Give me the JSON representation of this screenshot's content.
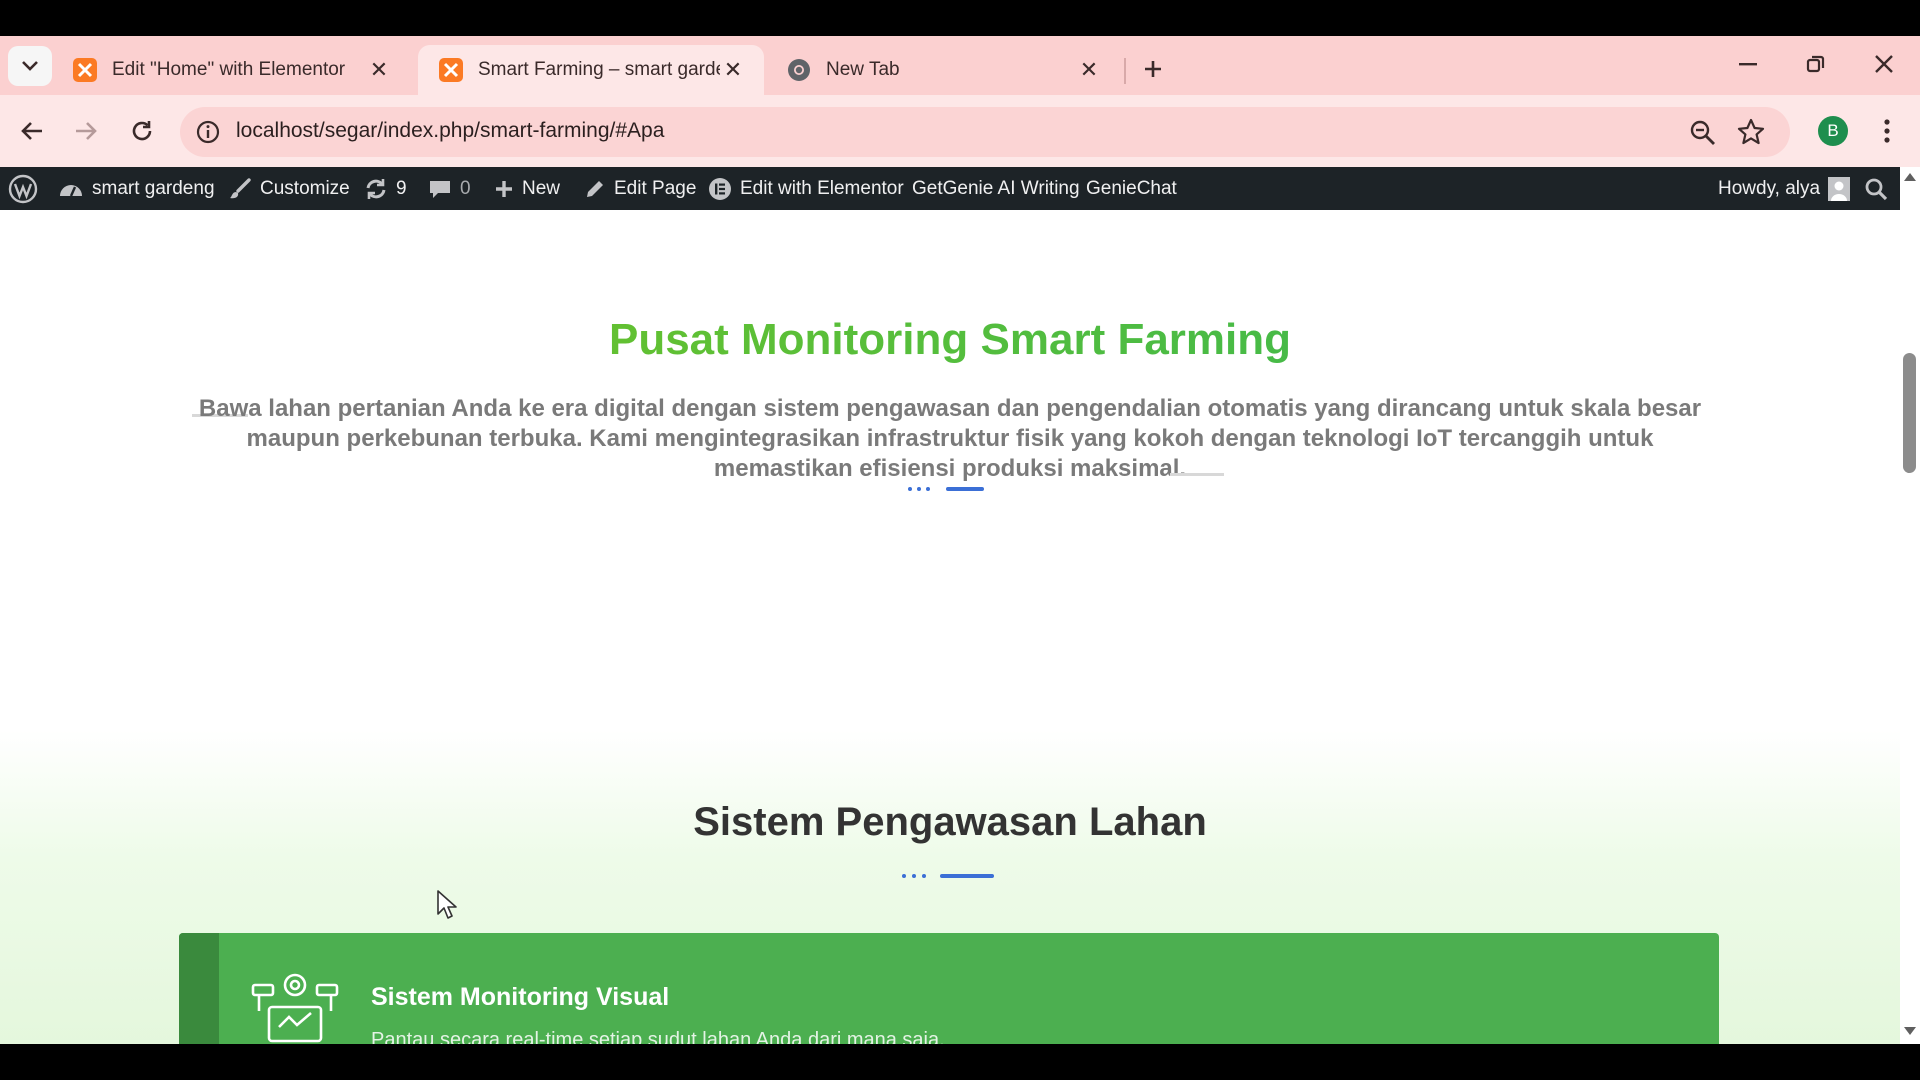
{
  "browser": {
    "tabs": [
      {
        "title": "Edit \"Home\" with Elementor",
        "active": false
      },
      {
        "title": "Smart Farming – smart gardeng",
        "active": true
      },
      {
        "title": "New Tab",
        "active": false
      }
    ],
    "url": "localhost/segar/index.php/smart-farming/#Apa",
    "profile_initial": "B",
    "colors": {
      "tabstrip": "#fbd0d0",
      "toolbar": "#fde7e7",
      "omnibox": "#fbd4d4",
      "profile": "#1e8e4e"
    }
  },
  "wp_admin_bar": {
    "site_name": "smart gardeng",
    "customize": "Customize",
    "updates_count": "9",
    "comments_count": "0",
    "new": "New",
    "edit_page": "Edit Page",
    "edit_with_elementor": "Edit with Elementor",
    "getgenie": "GetGenie AI Writing",
    "geniechat": "GenieChat",
    "howdy": "Howdy, alya"
  },
  "page": {
    "hero_title": "Pusat Monitoring Smart Farming",
    "hero_description": "Bawa lahan pertanian Anda ke era digital dengan sistem pengawasan dan pengendalian otomatis yang dirancang untuk skala besar maupun perkebunan terbuka. Kami mengintegrasikan infrastruktur fisik yang kokoh dengan teknologi IoT tercanggih untuk memastikan efisiensi produksi maksimal.",
    "section_title": "Sistem Pengawasan Lahan",
    "card": {
      "title": "Sistem Monitoring Visual",
      "description": "Pantau secara real-time setiap sudut lahan Anda dari mana saja.",
      "icon": "cctv-monitor-icon"
    },
    "colors": {
      "title_green": "#4cc23f",
      "accent_blue": "#3b6fd6",
      "card_green": "#4caf50",
      "card_accent": "#3a8a3d"
    }
  }
}
